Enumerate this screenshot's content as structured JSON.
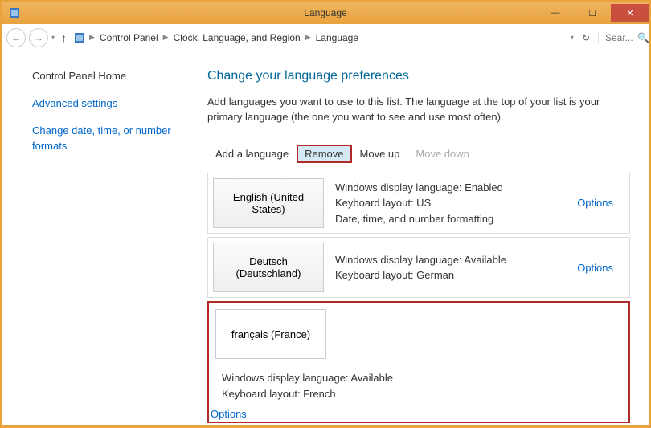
{
  "window": {
    "title": "Language"
  },
  "nav": {
    "breadcrumb": [
      "Control Panel",
      "Clock, Language, and Region",
      "Language"
    ],
    "search_placeholder": "Sear..."
  },
  "sidebar": {
    "links": [
      "Control Panel Home",
      "Advanced settings",
      "Change date, time, or number formats"
    ]
  },
  "main": {
    "heading": "Change your language preferences",
    "description": "Add languages you want to use to this list. The language at the top of your list is your primary language (the one you want to see and use most often).",
    "toolbar": {
      "add": "Add a language",
      "remove": "Remove",
      "move_up": "Move up",
      "move_down": "Move down"
    },
    "languages": [
      {
        "name": "English (United States)",
        "details": "Windows display language: Enabled\nKeyboard layout: US\nDate, time, and number formatting",
        "options": "Options",
        "selected": false
      },
      {
        "name": "Deutsch (Deutschland)",
        "details": "Windows display language: Available\nKeyboard layout: German",
        "options": "Options",
        "selected": false
      },
      {
        "name": "français (France)",
        "details": "Windows display language: Available\nKeyboard layout: French",
        "options": "Options",
        "selected": true
      }
    ]
  }
}
